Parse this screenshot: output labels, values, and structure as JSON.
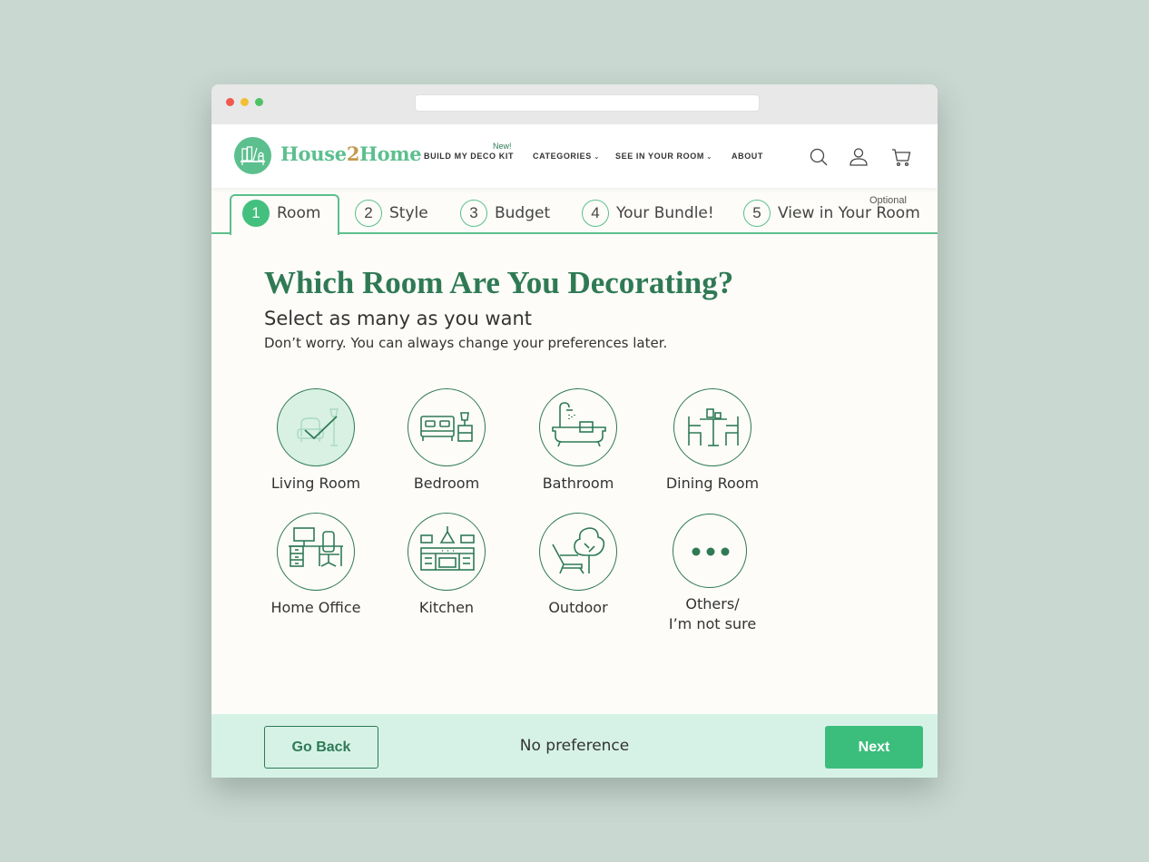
{
  "brand": {
    "name_part1": "House",
    "name_num": "2",
    "name_part2": "Home"
  },
  "nav": {
    "new_tag": "New!",
    "items": [
      {
        "label": "BUILD MY DECO KIT"
      },
      {
        "label": "CATEGORIES",
        "chevron": "⌄"
      },
      {
        "label": "SEE IN YOUR ROOM",
        "chevron": "⌄"
      },
      {
        "label": "ABOUT"
      }
    ]
  },
  "header_icons": [
    "search-icon",
    "user-icon",
    "cart-icon"
  ],
  "steps": {
    "optional_label": "Optional",
    "items": [
      {
        "num": "1",
        "label": "Room",
        "active": true
      },
      {
        "num": "2",
        "label": "Style"
      },
      {
        "num": "3",
        "label": "Budget"
      },
      {
        "num": "4",
        "label": "Your Bundle!"
      },
      {
        "num": "5",
        "label": "View in Your Room"
      }
    ]
  },
  "main": {
    "title": "Which Room Are You Decorating?",
    "subtitle": "Select as many as you want",
    "helper": "Don’t worry. You can always change your preferences later."
  },
  "rooms": [
    {
      "label": "Living Room",
      "icon": "living-room-icon",
      "selected": true
    },
    {
      "label": "Bedroom",
      "icon": "bed-icon"
    },
    {
      "label": "Bathroom",
      "icon": "bathtub-icon"
    },
    {
      "label": "Dining Room",
      "icon": "dining-table-icon"
    },
    {
      "label": "Home Office",
      "icon": "desk-icon"
    },
    {
      "label": "Kitchen",
      "icon": "kitchen-icon"
    },
    {
      "label": "Outdoor",
      "icon": "tree-chair-icon"
    },
    {
      "label": "Others/\nI’m not sure",
      "label_line1": "Others/",
      "label_line2": "I’m not sure",
      "icon": "more-dots-icon"
    }
  ],
  "footer": {
    "back_label": "Go Back",
    "no_preference": "No preference",
    "next_label": "Next"
  },
  "colors": {
    "accent": "#5cbf8e",
    "dark_green": "#2f7a55",
    "next_button": "#3bbd7c",
    "footer_bg": "#d6f2e6",
    "selected_bg": "#d8f1e3",
    "page_bg": "#c9d8d1"
  }
}
